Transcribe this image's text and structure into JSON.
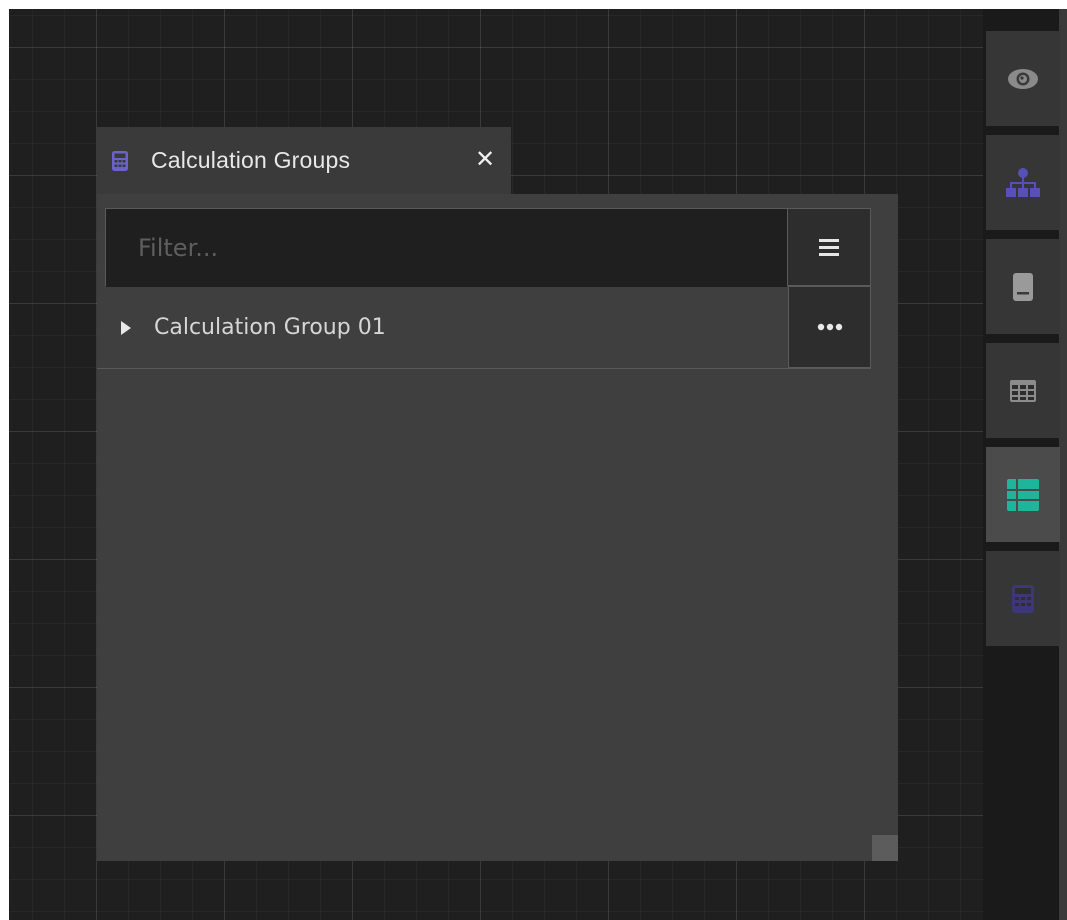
{
  "window": {
    "tab_title": "Calculation Groups",
    "tab_icon": "calculator-icon",
    "close_label": "✕"
  },
  "filter": {
    "placeholder": "Filter...",
    "value": ""
  },
  "tree": {
    "items": [
      {
        "label": "Calculation Group 01",
        "expanded": false
      }
    ]
  },
  "sidebar": {
    "items": [
      {
        "icon": "eye-icon",
        "active": false
      },
      {
        "icon": "hierarchy-icon",
        "active": false
      },
      {
        "icon": "document-icon",
        "active": false
      },
      {
        "icon": "table-grid-icon",
        "active": false
      },
      {
        "icon": "table-list-icon",
        "active": true
      },
      {
        "icon": "calculator-icon",
        "active": false
      }
    ]
  },
  "colors": {
    "canvas": "#1f1f1f",
    "panel": "#3f3f3f",
    "tab": "#3a3a3a",
    "accent_purple": "#6a63c9",
    "accent_teal": "#1fb59a"
  }
}
